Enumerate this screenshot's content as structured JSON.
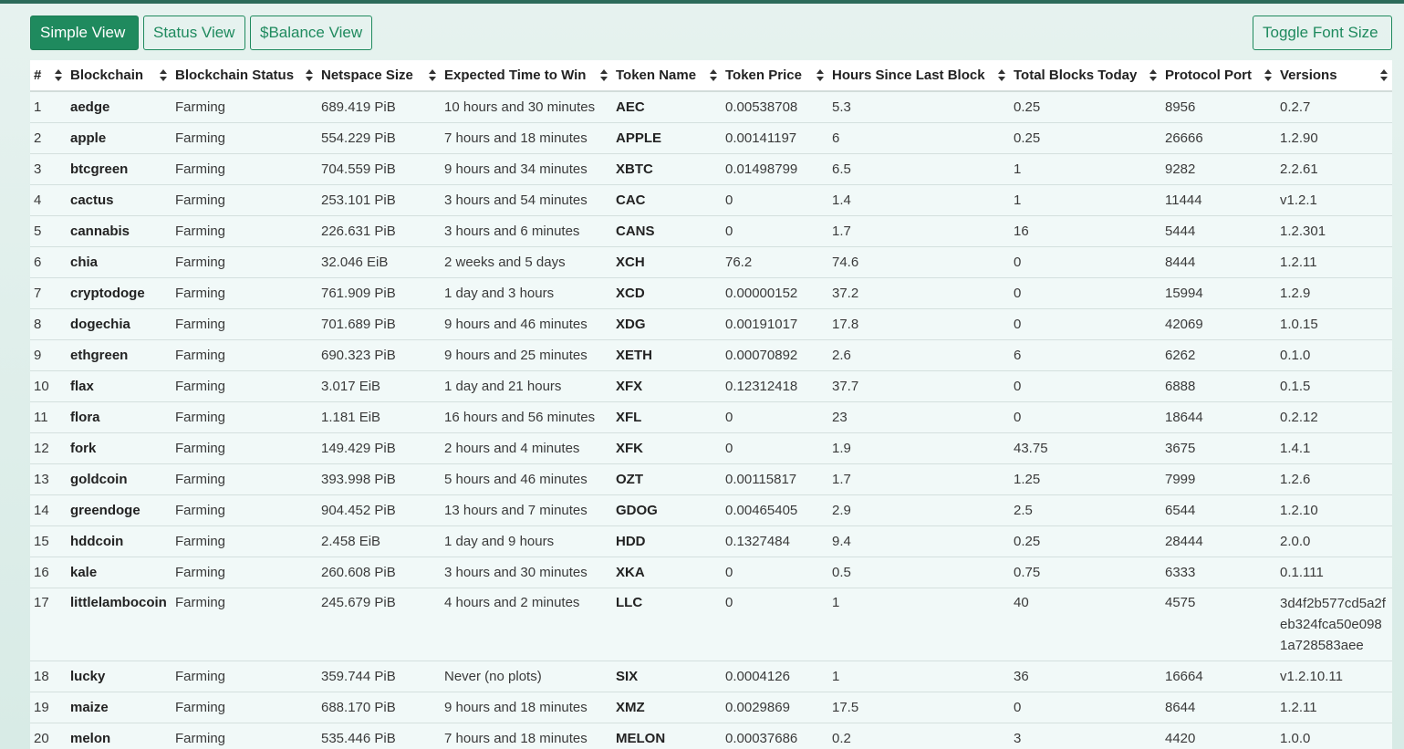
{
  "buttons": {
    "simple": "Simple View",
    "status": "Status View",
    "balance": "$Balance View",
    "font": "Toggle Font Size"
  },
  "table": {
    "columns": [
      "#",
      "Blockchain",
      "Blockchain Status",
      "Netspace Size",
      "Expected Time to Win",
      "Token Name",
      "Token Price",
      "Hours Since Last Block",
      "Total Blocks Today",
      "Protocol Port",
      "Versions"
    ],
    "rows": [
      [
        "1",
        "aedge",
        "Farming",
        "689.419 PiB",
        "10 hours and 30 minutes",
        "AEC",
        "0.00538708",
        "5.3",
        "0.25",
        "8956",
        "0.2.7"
      ],
      [
        "2",
        "apple",
        "Farming",
        "554.229 PiB",
        "7 hours and 18 minutes",
        "APPLE",
        "0.00141197",
        "6",
        "0.25",
        "26666",
        "1.2.90"
      ],
      [
        "3",
        "btcgreen",
        "Farming",
        "704.559 PiB",
        "9 hours and 34 minutes",
        "XBTC",
        "0.01498799",
        "6.5",
        "1",
        "9282",
        "2.2.61"
      ],
      [
        "4",
        "cactus",
        "Farming",
        "253.101 PiB",
        "3 hours and 54 minutes",
        "CAC",
        "0",
        "1.4",
        "1",
        "11444",
        "v1.2.1"
      ],
      [
        "5",
        "cannabis",
        "Farming",
        "226.631 PiB",
        "3 hours and 6 minutes",
        "CANS",
        "0",
        "1.7",
        "16",
        "5444",
        "1.2.301"
      ],
      [
        "6",
        "chia",
        "Farming",
        "32.046 EiB",
        "2 weeks and 5 days",
        "XCH",
        "76.2",
        "74.6",
        "0",
        "8444",
        "1.2.11"
      ],
      [
        "7",
        "cryptodoge",
        "Farming",
        "761.909 PiB",
        "1 day and 3 hours",
        "XCD",
        "0.00000152",
        "37.2",
        "0",
        "15994",
        "1.2.9"
      ],
      [
        "8",
        "dogechia",
        "Farming",
        "701.689 PiB",
        "9 hours and 46 minutes",
        "XDG",
        "0.00191017",
        "17.8",
        "0",
        "42069",
        "1.0.15"
      ],
      [
        "9",
        "ethgreen",
        "Farming",
        "690.323 PiB",
        "9 hours and 25 minutes",
        "XETH",
        "0.00070892",
        "2.6",
        "6",
        "6262",
        "0.1.0"
      ],
      [
        "10",
        "flax",
        "Farming",
        "3.017 EiB",
        "1 day and 21 hours",
        "XFX",
        "0.12312418",
        "37.7",
        "0",
        "6888",
        "0.1.5"
      ],
      [
        "11",
        "flora",
        "Farming",
        "1.181 EiB",
        "16 hours and 56 minutes",
        "XFL",
        "0",
        "23",
        "0",
        "18644",
        "0.2.12"
      ],
      [
        "12",
        "fork",
        "Farming",
        "149.429 PiB",
        "2 hours and 4 minutes",
        "XFK",
        "0",
        "1.9",
        "43.75",
        "3675",
        "1.4.1"
      ],
      [
        "13",
        "goldcoin",
        "Farming",
        "393.998 PiB",
        "5 hours and 46 minutes",
        "OZT",
        "0.00115817",
        "1.7",
        "1.25",
        "7999",
        "1.2.6"
      ],
      [
        "14",
        "greendoge",
        "Farming",
        "904.452 PiB",
        "13 hours and 7 minutes",
        "GDOG",
        "0.00465405",
        "2.9",
        "2.5",
        "6544",
        "1.2.10"
      ],
      [
        "15",
        "hddcoin",
        "Farming",
        "2.458 EiB",
        "1 day and 9 hours",
        "HDD",
        "0.1327484",
        "9.4",
        "0.25",
        "28444",
        "2.0.0"
      ],
      [
        "16",
        "kale",
        "Farming",
        "260.608 PiB",
        "3 hours and 30 minutes",
        "XKA",
        "0",
        "0.5",
        "0.75",
        "6333",
        "0.1.111"
      ],
      [
        "17",
        "littlelambocoin",
        "Farming",
        "245.679 PiB",
        "4 hours and 2 minutes",
        "LLC",
        "0",
        "1",
        "40",
        "4575",
        "3d4f2b577cd5a2feb324fca50e0981a728583aee"
      ],
      [
        "18",
        "lucky",
        "Farming",
        "359.744 PiB",
        "Never (no plots)",
        "SIX",
        "0.0004126",
        "1",
        "36",
        "16664",
        "v1.2.10.11"
      ],
      [
        "19",
        "maize",
        "Farming",
        "688.170 PiB",
        "9 hours and 18 minutes",
        "XMZ",
        "0.0029869",
        "17.5",
        "0",
        "8644",
        "1.2.11"
      ],
      [
        "20",
        "melon",
        "Farming",
        "535.446 PiB",
        "7 hours and 18 minutes",
        "MELON",
        "0.00037686",
        "0.2",
        "3",
        "4420",
        "1.0.0"
      ]
    ]
  },
  "colors": {
    "accent": "#1f8a5e",
    "row_bg": "#f1f9f8",
    "page_bg": "#e0efeb"
  }
}
